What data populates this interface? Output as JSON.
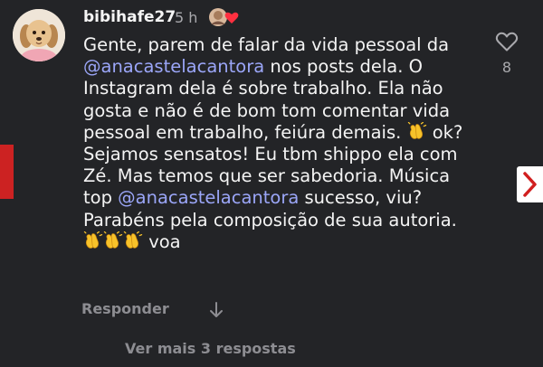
{
  "comment": {
    "username": "bibihafe27",
    "time": "5 h",
    "text_before_mention": "Gente, parem de falar da vida pessoal da ",
    "mention_1": "@anacastelacantora",
    "text_middle": " nos posts dela. O Instagram dela é sobre trabalho. Ela não gosta e não é de bom tom comentar vida pessoal em trabalho, feiúra demais. ",
    "text_after_emoji": " ok? Sejamos sensatos! Eu tbm shippo ela com Zé. Mas temos que ser sabedoria.  Música top ",
    "mention_2": "@anacastelacantora",
    "text_end": " sucesso, viu? Parabéns pela composição de sua autoria. ",
    "text_final": " voa",
    "emoji": "clapping-hands",
    "like_count": "8",
    "reply_label": "Responder",
    "view_replies_label": "Ver mais 3 respostas"
  },
  "colors": {
    "background": "#232427",
    "mention": "#9ba6f8",
    "muted": "#8d8d92",
    "heart_badge": "#ff3040"
  },
  "icons": {
    "like": "heart-outline-icon",
    "translate": "arrow-down-icon",
    "next": "chevron-right-icon",
    "liked_by_author": "author-avatar-heart-icon"
  }
}
